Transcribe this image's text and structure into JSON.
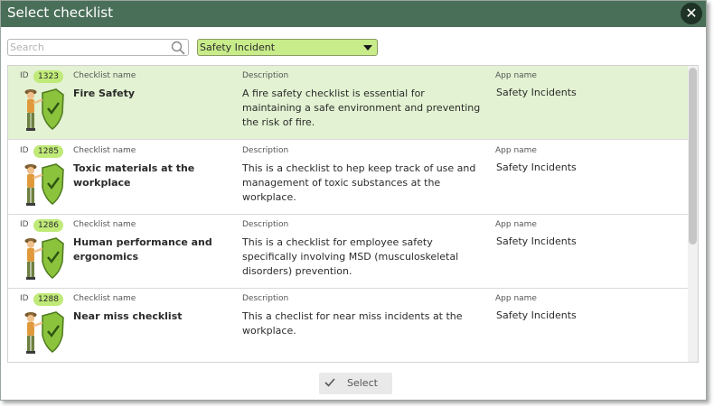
{
  "dialog": {
    "title": "Select checklist"
  },
  "search": {
    "placeholder": "Search",
    "value": ""
  },
  "filter": {
    "selected": "Safety Incident"
  },
  "columns": {
    "id": "ID",
    "name": "Checklist name",
    "description": "Description",
    "app": "App name"
  },
  "rows": [
    {
      "id": "1323",
      "name": "Fire Safety",
      "description": "A fire safety checklist is essential for maintaining a safe environment and preventing the risk of fire.",
      "app": "Safety Incidents",
      "selected": true
    },
    {
      "id": "1285",
      "name": "Toxic materials at the workplace",
      "description": "This is a checklist to hep keep track of use and management of toxic substances at the workplace.",
      "app": "Safety Incidents",
      "selected": false
    },
    {
      "id": "1286",
      "name": "Human performance and ergonomics",
      "description": "This is a checklist for employee safety specifically involving MSD (musculoskeletal disorders) prevention.",
      "app": "Safety Incidents",
      "selected": false
    },
    {
      "id": "1288",
      "name": "Near miss checklist",
      "description": "This a checlist for near miss incidents at the workplace.",
      "app": "Safety Incidents",
      "selected": false
    }
  ],
  "footer": {
    "select_label": "Select"
  },
  "colors": {
    "titlebar": "#4a6f58",
    "accent": "#c0ea78",
    "selected_row": "#e2f2d2"
  },
  "icons": {
    "close": "close-icon",
    "search": "search-icon",
    "dropdown": "chevron-down-icon",
    "row": "safety-worker-shield-icon",
    "select": "check-icon"
  }
}
